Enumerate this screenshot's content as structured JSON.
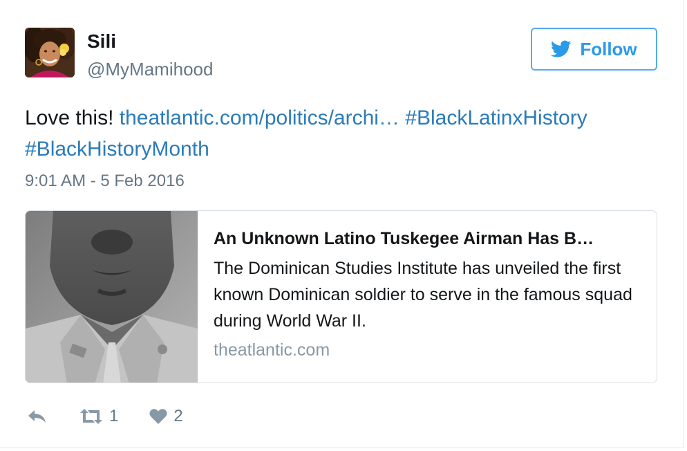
{
  "author": {
    "display_name": "Sili",
    "handle": "@MyMamihood",
    "avatar_icon": "profile-photo-woman"
  },
  "follow_button": {
    "label": "Follow",
    "icon": "twitter-bird-icon",
    "color": "#2b9ae8"
  },
  "tweet": {
    "text_prefix": "Love this!",
    "link": "theatlantic.com/politics/archi…",
    "hashtag_1": "#BlackLatinxHistory",
    "hashtag_2": "#BlackHistoryMonth",
    "timestamp": "9:01 AM - 5 Feb 2016",
    "link_color": "#2b7bb9"
  },
  "card": {
    "title": "An Unknown Latino Tuskegee Airman Has B…",
    "description": "The Dominican Studies Institute has unveiled the first known Dominican soldier to serve in the famous squad during World War II.",
    "domain": "theatlantic.com",
    "image_icon": "soldier-portrait-photo"
  },
  "actions": {
    "reply_icon": "reply-icon",
    "retweet_icon": "retweet-icon",
    "retweet_count": "1",
    "like_icon": "heart-icon",
    "like_count": "2",
    "icon_color": "#8899a6"
  }
}
